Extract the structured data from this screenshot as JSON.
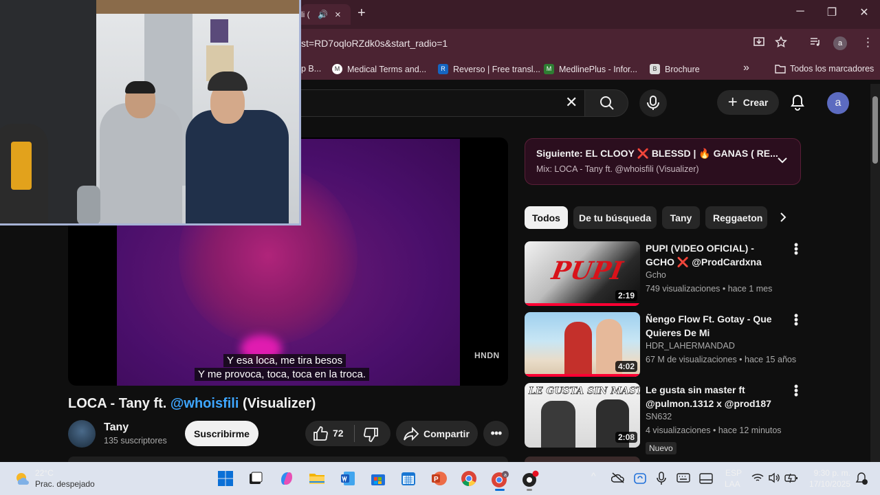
{
  "tab": {
    "title": "li (",
    "close": "×",
    "new_tab": "+"
  },
  "window": {
    "minimize": "─",
    "maximize": "❐",
    "close": "✕"
  },
  "address_bar": {
    "url": "st=RD7oqloRZdk0s&start_radio=1"
  },
  "bookmarks": {
    "items": [
      {
        "label": "p B...",
        "icon": "bookmark-icon"
      },
      {
        "label": "Medical Terms and...",
        "icon": "mw-icon"
      },
      {
        "label": "Reverso | Free transl...",
        "icon": "reverso-icon"
      },
      {
        "label": "MedlinePlus - Infor...",
        "icon": "medlineplus-icon"
      },
      {
        "label": "Brochure",
        "icon": "brochure-icon"
      }
    ],
    "overflow": "»",
    "all_bookmarks": "Todos los marcadores"
  },
  "youtube_header": {
    "clear": "✕",
    "create_label": "Crear",
    "avatar_letter": "a"
  },
  "player": {
    "captions": [
      "Y esa loca, me tira besos",
      "Y me provoca, toca, toca en la troca."
    ],
    "watermark": "HNDN"
  },
  "video": {
    "title_prefix": "LOCA - Tany ft.",
    "title_mention": "@whoisfili",
    "title_suffix": "(Visualizer)",
    "channel_name": "Tany",
    "subscribers": "135 suscriptores",
    "subscribe_label": "Suscribirme",
    "likes": "72",
    "share_label": "Compartir",
    "more": "•••"
  },
  "up_next": {
    "title": "Siguiente: EL CLOOY ❌ BLESSD | 🔥 GANAS ( RE...",
    "subtitle": "Mix: LOCA - Tany ft. @whoisfili (Visualizer)"
  },
  "chips": [
    "Todos",
    "De tu búsqueda",
    "Tany",
    "Reggaeton"
  ],
  "recommendations": [
    {
      "title": "PUPI (VIDEO OFICIAL) - GCHO ❌ @ProdCardxna",
      "channel": "Gcho",
      "meta": "749 visualizaciones • hace 1 mes",
      "duration": "2:19",
      "thumb_text": "PUPI",
      "badge": ""
    },
    {
      "title": "Ñengo Flow Ft. Gotay - Que Quieres De Mi",
      "channel": "HDR_LAHERMANDAD",
      "meta": "67 M de visualizaciones • hace 15 años",
      "duration": "4:02",
      "thumb_text": "",
      "badge": ""
    },
    {
      "title": "Le gusta sin master ft @pulmon.1312 x @prod187",
      "channel": "SN632",
      "meta": "4 visualizaciones • hace 12 minutos",
      "duration": "2:08",
      "thumb_text": "LE GUSTA SIN MASTER",
      "badge": "Nuevo"
    }
  ],
  "taskbar": {
    "temperature": "22°C",
    "weather": "Prac. despejado",
    "lang_line1": "ESP",
    "lang_line2": "LAA",
    "time": "9:30 p. m.",
    "date": "17/10/2025",
    "chevron": "^"
  },
  "colors": {
    "chrome_frame": "#3b1c28",
    "chrome_toolbar": "#4b2332",
    "youtube_bg": "#0f0f0f",
    "link_blue": "#3ea6ff",
    "progress_red": "#ff0033",
    "taskbar": "#dde3ee"
  }
}
